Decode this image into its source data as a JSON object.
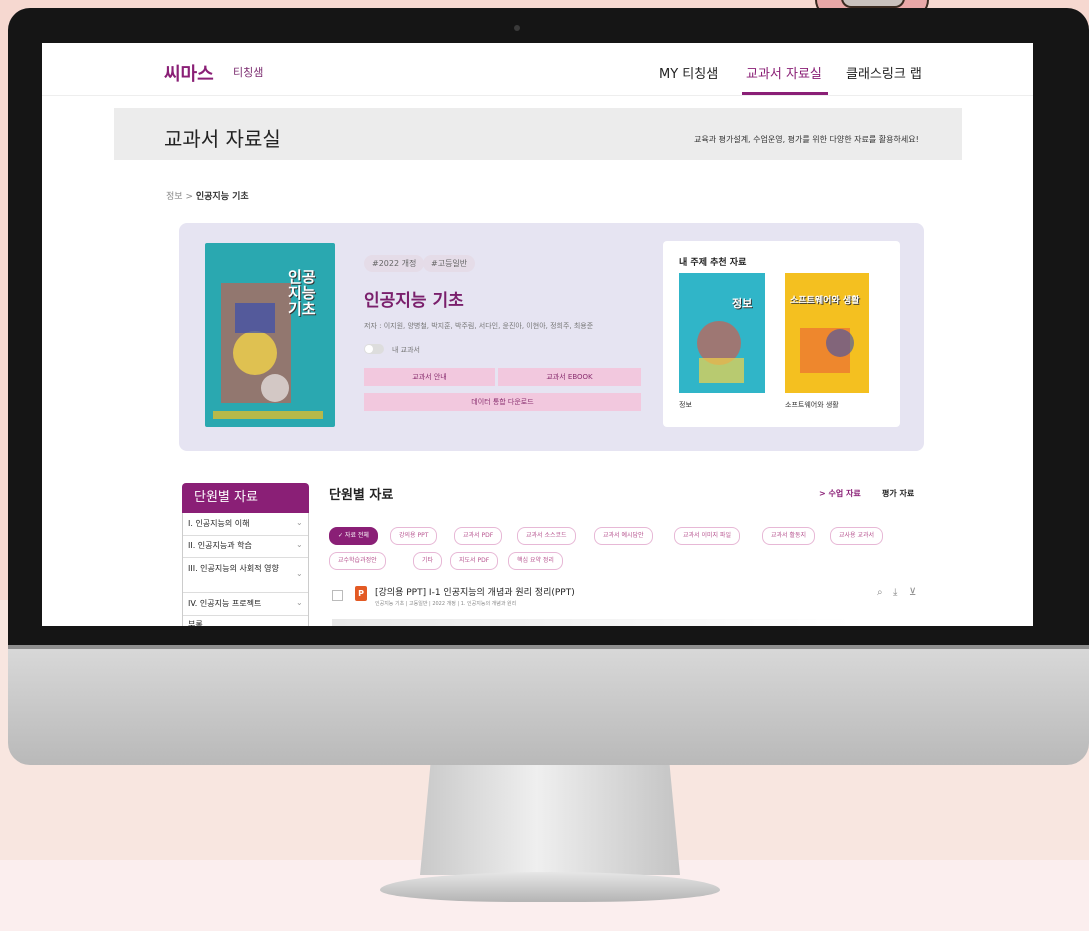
{
  "colors": {
    "brand": "#8a1f76",
    "chip_border": "#e7b8d6",
    "hero_bg": "#e6e4f2",
    "book_cover": "#2aa8b0"
  },
  "header": {
    "logo": "씨마스",
    "logo_sub": "티칭샘",
    "nav": [
      "MY 티칭샘",
      "교과서 자료실",
      "클래스링크 랩"
    ],
    "active_nav": "교과서 자료실"
  },
  "banner": {
    "title": "교과서 자료실",
    "description": "교육과 평가설계, 수업운영, 평가를 위한 다양한 자료를 활용하세요!"
  },
  "breadcrumb": {
    "parent": "정보",
    "separator": ">",
    "current": "인공지능 기초"
  },
  "book": {
    "cover_title": "인공지능 기초",
    "tags": [
      "#2022 개정",
      "#고등일반"
    ],
    "name": "인공지능 기초",
    "authors": "저자 : 이지원, 양병철, 박지훈, 박주림, 서다인, 윤진아, 이현아, 정희주, 최용준",
    "toggle_label": "내 교과서",
    "buttons": {
      "guide": "교과서 안내",
      "ebook": "교과서 EBOOK",
      "download": "데이터 통합 다운로드"
    }
  },
  "recommend": {
    "title": "내 주제 추천 자료",
    "books": [
      {
        "cover": "정보",
        "label": "정보"
      },
      {
        "cover": "소프트웨어와 생활",
        "label": "소프트웨어와 생활"
      }
    ]
  },
  "sidebar": {
    "title": "단원별 자료",
    "items": [
      "I. 인공지능의 이해",
      "II. 인공지능과 학습",
      "III. 인공지능의 사회적 영향",
      "IV. 인공지능 프로젝트",
      "부록"
    ]
  },
  "main": {
    "title": "단원별 자료",
    "links": [
      "> 수업 자료",
      "평가 자료"
    ],
    "filters": [
      "✓ 자료 전체",
      "강의용 PPT",
      "교과서 PDF",
      "교과서 소스코드",
      "교과서 예시답안",
      "교과서 이미지 파일",
      "교과서 활동지",
      "교사용 교과서",
      "교수학습과정안",
      "기타",
      "지도서 PDF",
      "핵심 요약 정리"
    ],
    "item": {
      "title": "[강의용 PPT] Ⅰ-1 인공지능의 개념과 원리 정리(PPT)",
      "meta": "인공지능 기초 | 고등일반 | 2022 개정 | 1. 인공지능의 개념과 원리",
      "file_icon": "P"
    }
  },
  "icons": {
    "preview": "magnifier-icon",
    "download": "download-icon",
    "pin": "pin-icon",
    "chevron": "chevron-down-icon"
  }
}
